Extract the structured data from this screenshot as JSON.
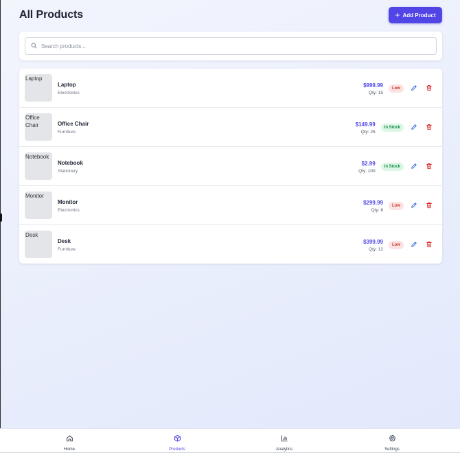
{
  "header": {
    "title": "All Products",
    "add_label": "Add Product"
  },
  "search": {
    "placeholder": "Search products...",
    "value": ""
  },
  "products": [
    {
      "name": "Laptop",
      "category": "Electronics",
      "image_alt": "Laptop",
      "price": "$999.99",
      "qty": "Qty: 15",
      "status": "Low"
    },
    {
      "name": "Office Chair",
      "category": "Furniture",
      "image_alt": "Office Chair",
      "price": "$149.99",
      "qty": "Qty: 25",
      "status": "In Stock"
    },
    {
      "name": "Notebook",
      "category": "Stationery",
      "image_alt": "Notebook",
      "price": "$2.99",
      "qty": "Qty: 100",
      "status": "In Stock"
    },
    {
      "name": "Monitor",
      "category": "Electronics",
      "image_alt": "Monitor",
      "price": "$299.99",
      "qty": "Qty: 8",
      "status": "Low"
    },
    {
      "name": "Desk",
      "category": "Furniture",
      "image_alt": "Desk",
      "price": "$399.99",
      "qty": "Qty: 12",
      "status": "Low"
    }
  ],
  "nav": {
    "items": [
      {
        "label": "Home",
        "icon": "home-icon"
      },
      {
        "label": "Products",
        "icon": "box-icon"
      },
      {
        "label": "Analytics",
        "icon": "bar-chart-icon"
      },
      {
        "label": "Settings",
        "icon": "gear-icon"
      }
    ],
    "active": "Products"
  },
  "colors": {
    "accent": "#5145e5",
    "price": "#4f46e5",
    "low_bg": "#fde2e2",
    "low_text": "#c0392b",
    "instock_bg": "#dcf7e6",
    "instock_text": "#178a46",
    "edit": "#3b6fd8",
    "delete": "#dc2626"
  }
}
